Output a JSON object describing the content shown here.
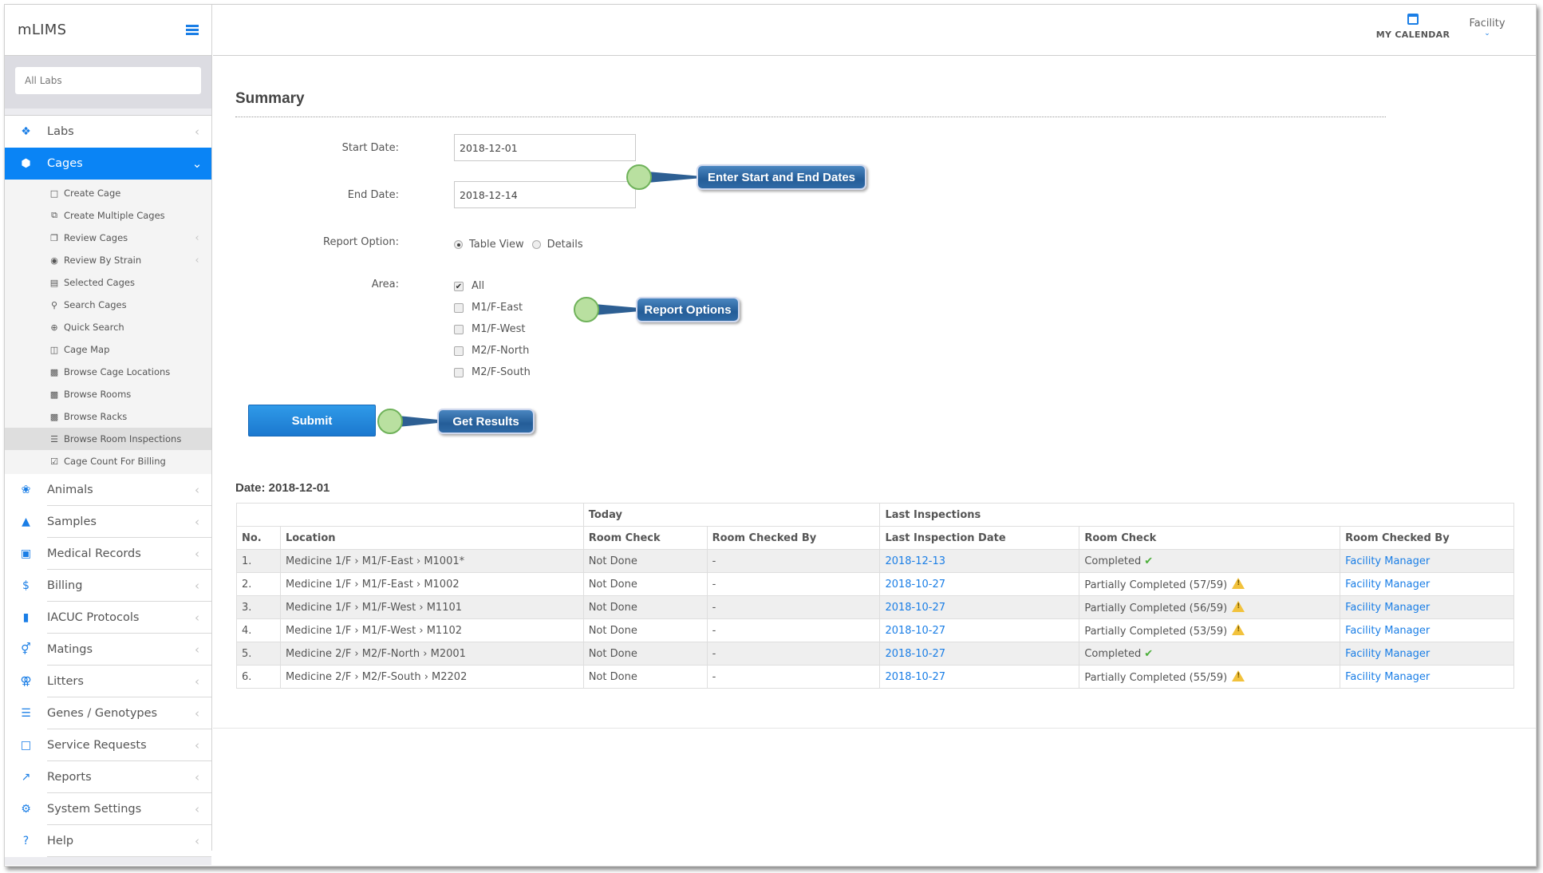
{
  "app": {
    "title": "mLIMS",
    "lab_selector": {
      "value": "All Labs",
      "placeholder": "All Labs"
    }
  },
  "header": {
    "calendar_label": "MY CALENDAR",
    "facility_label": "Facility"
  },
  "sidebar": {
    "items": [
      {
        "label": "Labs",
        "icon": "users-icon"
      },
      {
        "label": "Cages",
        "icon": "cube-icon",
        "active": true
      },
      {
        "label": "Animals",
        "icon": "paw-icon"
      },
      {
        "label": "Samples",
        "icon": "flask-icon"
      },
      {
        "label": "Medical Records",
        "icon": "medkit-icon"
      },
      {
        "label": "Billing",
        "icon": "dollar-icon"
      },
      {
        "label": "IACUC Protocols",
        "icon": "book-icon"
      },
      {
        "label": "Matings",
        "icon": "mars-venus-icon"
      },
      {
        "label": "Litters",
        "icon": "venus-double-icon"
      },
      {
        "label": "Genes / Genotypes",
        "icon": "bars-icon"
      },
      {
        "label": "Service Requests",
        "icon": "sticky-note-icon"
      },
      {
        "label": "Reports",
        "icon": "line-chart-icon"
      },
      {
        "label": "System Settings",
        "icon": "gear-icon"
      },
      {
        "label": "Help",
        "icon": "question-icon"
      }
    ],
    "cages_submenu": [
      {
        "label": "Create Cage",
        "icon": "file-icon"
      },
      {
        "label": "Create Multiple Cages",
        "icon": "files-icon"
      },
      {
        "label": "Review Cages",
        "icon": "clone-icon",
        "has_children": true
      },
      {
        "label": "Review By Strain",
        "icon": "dot-circle-icon",
        "has_children": true
      },
      {
        "label": "Selected Cages",
        "icon": "cart-icon"
      },
      {
        "label": "Search Cages",
        "icon": "search-icon"
      },
      {
        "label": "Quick Search",
        "icon": "search-plus-icon"
      },
      {
        "label": "Cage Map",
        "icon": "map-icon"
      },
      {
        "label": "Browse Cage Locations",
        "icon": "building-icon"
      },
      {
        "label": "Browse Rooms",
        "icon": "building-icon"
      },
      {
        "label": "Browse Racks",
        "icon": "building-icon"
      },
      {
        "label": "Browse Room Inspections",
        "icon": "list-icon",
        "active": true
      },
      {
        "label": "Cage Count For Billing",
        "icon": "check-square-icon"
      }
    ]
  },
  "page": {
    "title": "Summary",
    "form": {
      "start_date_label": "Start Date:",
      "start_date_value": "2018-12-01",
      "end_date_label": "End Date:",
      "end_date_value": "2018-12-14",
      "report_option_label": "Report Option:",
      "report_options": [
        {
          "label": "Table View",
          "selected": true
        },
        {
          "label": "Details",
          "selected": false
        }
      ],
      "area_label": "Area:",
      "areas": [
        {
          "label": "All",
          "checked": true
        },
        {
          "label": "M1/F-East",
          "checked": false
        },
        {
          "label": "M1/F-West",
          "checked": false
        },
        {
          "label": "M2/F-North",
          "checked": false
        },
        {
          "label": "M2/F-South",
          "checked": false
        }
      ],
      "submit_label": "Submit"
    },
    "callouts": {
      "dates": "Enter Start and End Dates",
      "options": "Report Options",
      "results": "Get Results"
    },
    "results": {
      "date_heading": "Date: 2018-12-01",
      "group_headers": {
        "today": "Today",
        "last": "Last Inspections"
      },
      "columns": [
        "No.",
        "Location",
        "Room Check",
        "Room Checked By",
        "Last Inspection Date",
        "Room Check",
        "Room Checked By"
      ],
      "rows": [
        {
          "no": "1.",
          "location": "Medicine 1/F › M1/F-East › M1001*",
          "today_check": "Not Done",
          "today_by": "-",
          "last_date": "2018-12-13",
          "last_check": "Completed",
          "status": "ok",
          "last_by": "Facility Manager"
        },
        {
          "no": "2.",
          "location": "Medicine 1/F › M1/F-East › M1002",
          "today_check": "Not Done",
          "today_by": "-",
          "last_date": "2018-10-27",
          "last_check": "Partially Completed (57/59)",
          "status": "warn",
          "last_by": "Facility Manager"
        },
        {
          "no": "3.",
          "location": "Medicine 1/F › M1/F-West › M1101",
          "today_check": "Not Done",
          "today_by": "-",
          "last_date": "2018-10-27",
          "last_check": "Partially Completed (56/59)",
          "status": "warn",
          "last_by": "Facility Manager"
        },
        {
          "no": "4.",
          "location": "Medicine 1/F › M1/F-West › M1102",
          "today_check": "Not Done",
          "today_by": "-",
          "last_date": "2018-10-27",
          "last_check": "Partially Completed (53/59)",
          "status": "warn",
          "last_by": "Facility Manager"
        },
        {
          "no": "5.",
          "location": "Medicine 2/F › M2/F-North › M2001",
          "today_check": "Not Done",
          "today_by": "-",
          "last_date": "2018-10-27",
          "last_check": "Completed",
          "status": "ok",
          "last_by": "Facility Manager"
        },
        {
          "no": "6.",
          "location": "Medicine 2/F › M2/F-South › M2202",
          "today_check": "Not Done",
          "today_by": "-",
          "last_date": "2018-10-27",
          "last_check": "Partially Completed (55/59)",
          "status": "warn",
          "last_by": "Facility Manager"
        }
      ]
    }
  },
  "colors": {
    "accent": "#0a84f5",
    "link": "#1a7ee6",
    "ok": "#4caf3a",
    "warn": "#f2c23c"
  }
}
